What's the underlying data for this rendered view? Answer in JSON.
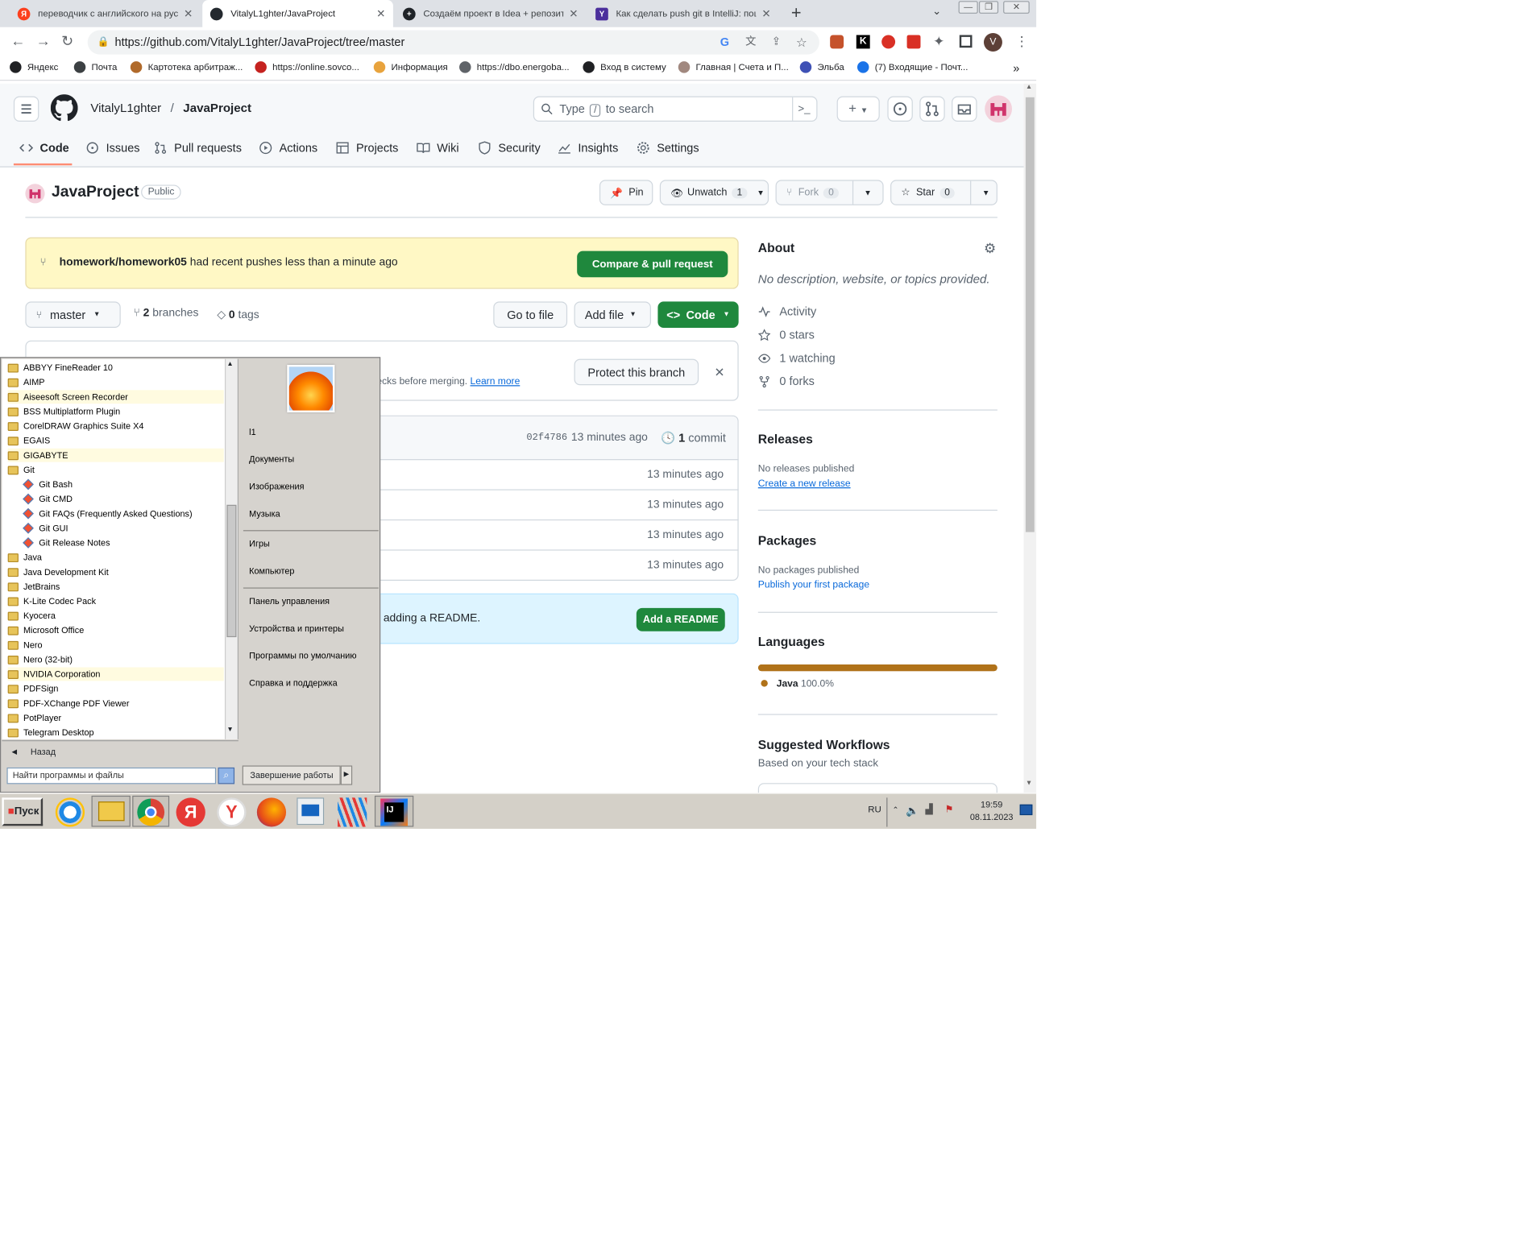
{
  "browser": {
    "tabs": [
      {
        "title": "переводчик с английского на русс",
        "favicon_color": "#fc3f1d",
        "favicon_letter": "Я"
      },
      {
        "title": "VitalyL1ghter/JavaProject",
        "favicon_color": "#24292f",
        "favicon_letter": ""
      },
      {
        "title": "Создаём проект в Idea + репозито",
        "favicon_color": "#1f2328",
        "favicon_letter": "+"
      },
      {
        "title": "Как сделать push git в IntelliJ: пош",
        "favicon_color": "#4b2f9c",
        "favicon_letter": "Y"
      }
    ],
    "new_tab": "+",
    "url": "https://github.com/VitalyL1ghter/JavaProject/tree/master",
    "profile_letter": "V",
    "bookmarks": [
      {
        "label": "Яндекс",
        "color": "#202124"
      },
      {
        "label": "Почта",
        "color": "#3c4043"
      },
      {
        "label": "Картотека арбитраж...",
        "color": "#b06a2b"
      },
      {
        "label": "https://online.sovco...",
        "color": "#c5221f"
      },
      {
        "label": "Информация",
        "color": "#e8a33d"
      },
      {
        "label": "https://dbo.energoba...",
        "color": "#5f6368"
      },
      {
        "label": "Вход в систему",
        "color": "#202124"
      },
      {
        "label": "Главная | Счета и П...",
        "color": "#a1887f"
      },
      {
        "label": "Эльба",
        "color": "#3f51b5"
      },
      {
        "label": "(7) Входящие - Почт...",
        "color": "#1a73e8"
      }
    ],
    "more_bookmarks": "»"
  },
  "github": {
    "owner": "VitalyL1ghter",
    "slash": "/",
    "repo": "JavaProject",
    "search_placeholder_pre": "Type",
    "search_key": "/",
    "search_placeholder_post": "to search",
    "nav": [
      "Code",
      "Issues",
      "Pull requests",
      "Actions",
      "Projects",
      "Wiki",
      "Security",
      "Insights",
      "Settings"
    ],
    "repo_title": "JavaProject",
    "visibility": "Public",
    "pin": "Pin",
    "unwatch": "Unwatch",
    "unwatch_count": "1",
    "fork": "Fork",
    "fork_count": "0",
    "star": "Star",
    "star_count": "0",
    "banner_branch": "homework/homework05",
    "banner_text": "had recent pushes less than a minute ago",
    "compare_button": "Compare & pull request",
    "branch": "master",
    "branches_count": "2",
    "branches_label": "branches",
    "tags_count": "0",
    "tags_label": "tags",
    "go_to_file": "Go to file",
    "add_file": "Add file",
    "code_button": "Code",
    "protect_text": "ecks before merging.",
    "learn_more": "Learn more",
    "protect_button": "Protect this branch",
    "commit_hash": "02f4786",
    "commit_ago": "13 minutes ago",
    "commits_count": "1",
    "commits_label": "commit",
    "rows_ago": [
      "13 minutes ago",
      "13 minutes ago",
      "13 minutes ago",
      "13 minutes ago"
    ],
    "readme_text": "adding a README.",
    "add_readme": "Add a README",
    "about_title": "About",
    "about_desc": "No description, website, or topics provided.",
    "about_items": [
      "Activity",
      "0 stars",
      "1 watching",
      "0 forks"
    ],
    "releases_title": "Releases",
    "releases_none": "No releases published",
    "releases_link": "Create a new release",
    "packages_title": "Packages",
    "packages_none": "No packages published",
    "packages_link": "Publish your first package",
    "languages_title": "Languages",
    "language_name": "Java",
    "language_pct": "100.0%",
    "language_fraction": 1.0,
    "language_color": "#b07219",
    "workflows_title": "Suggested Workflows",
    "workflows_sub": "Based on your tech stack"
  },
  "startmenu": {
    "programs": [
      {
        "label": "ABBYY FineReader 10",
        "type": "folder",
        "hl": false
      },
      {
        "label": "AIMP",
        "type": "folder",
        "hl": false
      },
      {
        "label": "Aiseesoft Screen Recorder",
        "type": "folder",
        "hl": true
      },
      {
        "label": "BSS Multiplatform Plugin",
        "type": "folder",
        "hl": false
      },
      {
        "label": "CorelDRAW Graphics Suite X4",
        "type": "folder",
        "hl": false
      },
      {
        "label": "EGAIS",
        "type": "folder",
        "hl": false
      },
      {
        "label": "GIGABYTE",
        "type": "folder",
        "hl": true
      },
      {
        "label": "Git",
        "type": "folder",
        "hl": false
      },
      {
        "label": "Git Bash",
        "type": "git",
        "hl": false
      },
      {
        "label": "Git CMD",
        "type": "git",
        "hl": false
      },
      {
        "label": "Git FAQs (Frequently Asked Questions)",
        "type": "git",
        "hl": false
      },
      {
        "label": "Git GUI",
        "type": "git",
        "hl": false
      },
      {
        "label": "Git Release Notes",
        "type": "git",
        "hl": false
      },
      {
        "label": "Java",
        "type": "folder",
        "hl": false
      },
      {
        "label": "Java Development Kit",
        "type": "folder",
        "hl": false
      },
      {
        "label": "JetBrains",
        "type": "folder",
        "hl": false
      },
      {
        "label": "K-Lite Codec Pack",
        "type": "folder",
        "hl": false
      },
      {
        "label": "Kyocera",
        "type": "folder",
        "hl": false
      },
      {
        "label": "Microsoft Office",
        "type": "folder",
        "hl": false
      },
      {
        "label": "Nero",
        "type": "folder",
        "hl": false
      },
      {
        "label": "Nero (32-bit)",
        "type": "folder",
        "hl": false
      },
      {
        "label": "NVIDIA Corporation",
        "type": "folder",
        "hl": true
      },
      {
        "label": "PDFSign",
        "type": "folder",
        "hl": false
      },
      {
        "label": "PDF-XChange PDF Viewer",
        "type": "folder",
        "hl": false
      },
      {
        "label": "PotPlayer",
        "type": "folder",
        "hl": false
      },
      {
        "label": "Telegram Desktop",
        "type": "folder",
        "hl": false
      }
    ],
    "back": "Назад",
    "search_placeholder": "Найти программы и файлы",
    "right_items": [
      "l1",
      "Документы",
      "Изображения",
      "Музыка",
      "Игры",
      "Компьютер",
      "Панель управления",
      "Устройства и принтеры",
      "Программы по умолчанию",
      "Справка и поддержка"
    ],
    "shutdown": "Завершение работы"
  },
  "taskbar": {
    "start": "Пуск",
    "lang": "RU",
    "time": "19:59",
    "date": "08.11.2023"
  }
}
